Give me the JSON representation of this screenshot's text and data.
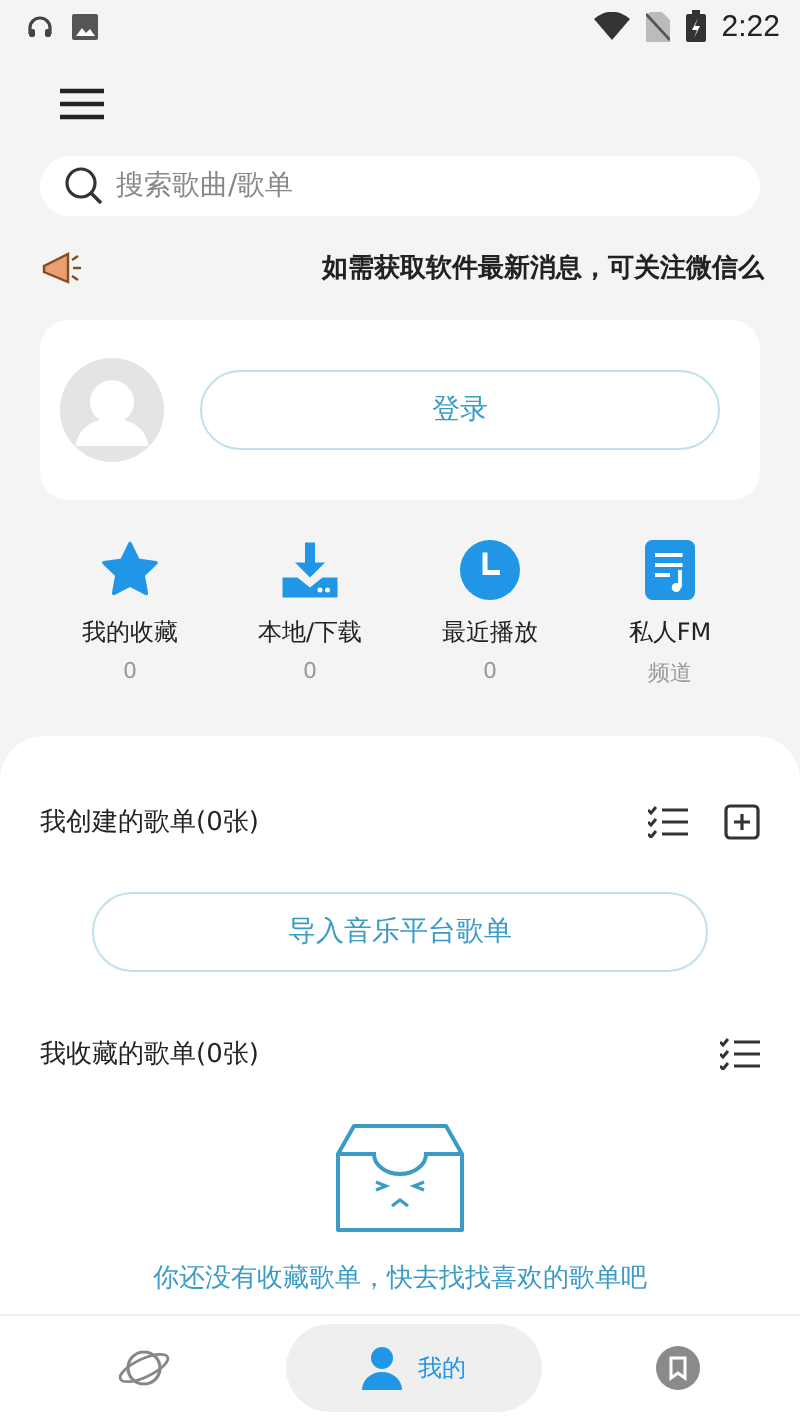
{
  "status_bar": {
    "time": "2:22"
  },
  "search": {
    "placeholder": "搜索歌曲/歌单"
  },
  "notice": "如需获取软件最新消息，可关注微信么",
  "login": {
    "button": "登录"
  },
  "shortcuts": [
    {
      "kind": "star",
      "label": "我的收藏",
      "sub": "0"
    },
    {
      "kind": "download",
      "label": "本地/下载",
      "sub": "0"
    },
    {
      "kind": "clock",
      "label": "最近播放",
      "sub": "0"
    },
    {
      "kind": "note",
      "label": "私人FM",
      "sub": "频道"
    }
  ],
  "created": {
    "title": "我创建的歌单(0张)",
    "import_button": "导入音乐平台歌单"
  },
  "collected": {
    "title": "我收藏的歌单(0张)",
    "empty_text": "你还没有收藏歌单，快去找找喜欢的歌单吧"
  },
  "nav": [
    {
      "kind": "planet",
      "selected": false
    },
    {
      "kind": "user",
      "label": "我的",
      "selected": true
    },
    {
      "kind": "bookmark",
      "selected": false
    }
  ]
}
